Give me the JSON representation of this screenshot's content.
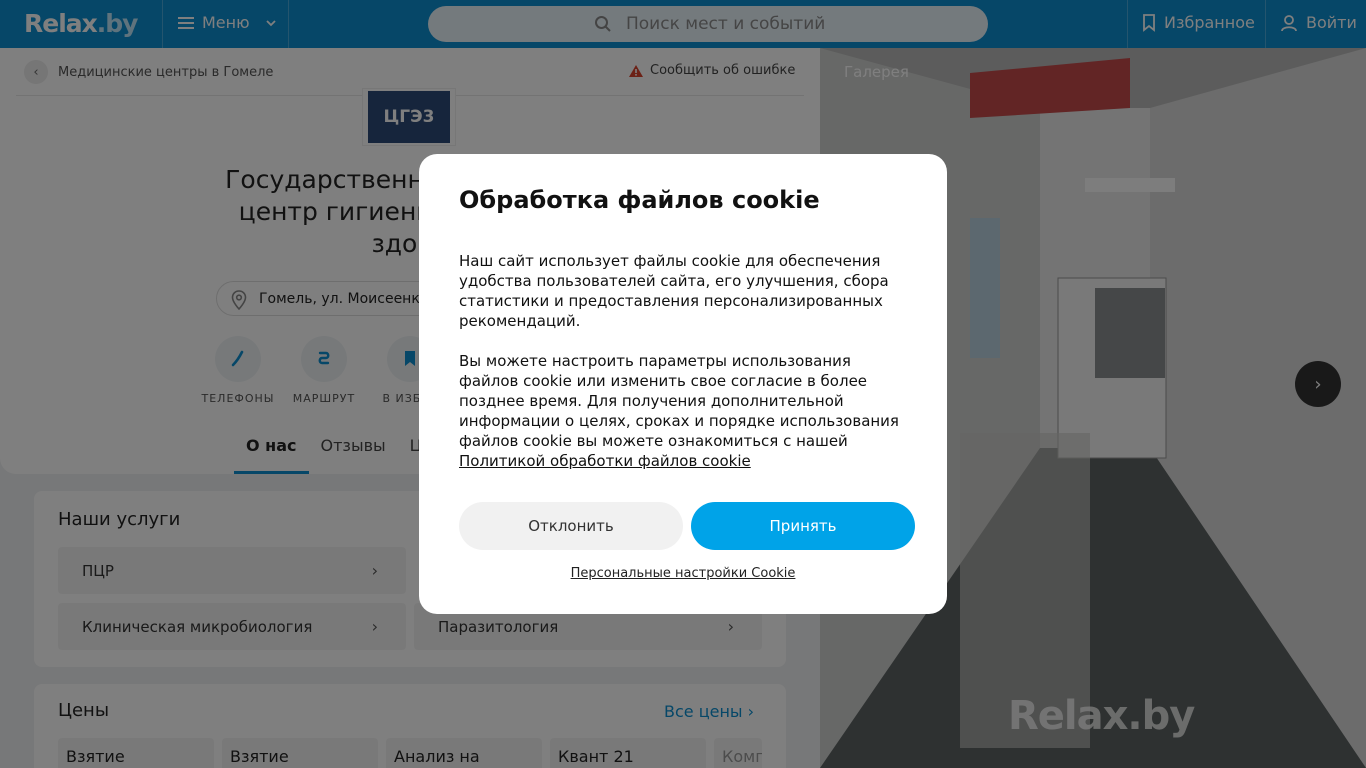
{
  "header": {
    "logo": "Relax",
    "logo_dot": ".by",
    "menu_label": "Меню",
    "search_placeholder": "Поиск мест и событий",
    "favorites_label": "Избранное",
    "login_label": "Войти"
  },
  "breadcrumb": {
    "label": "Медицинские центры в Гомеле"
  },
  "report_label": "Сообщить об ошибке",
  "org": {
    "logo_text": "ЦГЭ3",
    "title_line1": "Государственное учрежден",
    "title_line2": "центр гигиены, эпидемио",
    "title_line3": "здоро",
    "address": "Гомель, ул. Моисеенк"
  },
  "actions": [
    {
      "label": "ТЕЛЕФОНЫ",
      "icon": "phone-icon"
    },
    {
      "label": "МАРШРУТ",
      "icon": "route-icon"
    },
    {
      "label": "В ИЗБРА",
      "icon": "bookmark-icon"
    }
  ],
  "tabs": [
    "О нас",
    "Отзывы",
    "Це"
  ],
  "services": {
    "title": "Наши услуги",
    "items": [
      "ПЦР",
      "Клиническая микробиология",
      "Паразитология"
    ]
  },
  "prices": {
    "title": "Цены",
    "all_label": "Все цены",
    "tiles": [
      "Взятие",
      "Взятие",
      "Анализ на",
      "Квант 21",
      "Комп"
    ]
  },
  "gallery": {
    "label": "Галерея",
    "watermark": "Relax.by"
  },
  "cookie": {
    "title": "Обработка файлов cookie",
    "text1": "Наш сайт использует файлы cookie для обеспечения удобства пользователей сайта, его улучшения, сбора статистики и предоставления персонализированных рекомендаций.",
    "text2": "Вы можете настроить параметры использования файлов cookie или изменить свое согласие в более позднее время. Для получения дополнительной информации о целях, сроках и порядке использования файлов cookie вы можете ознакомиться с нашей",
    "policy_link": "Политикой обработки файлов cookie",
    "decline_label": "Отклонить",
    "accept_label": "Принять",
    "settings_label": "Персональные настройки Cookie"
  },
  "colors": {
    "header_bg": "#0c8fd0",
    "accent": "#00a3e8"
  }
}
